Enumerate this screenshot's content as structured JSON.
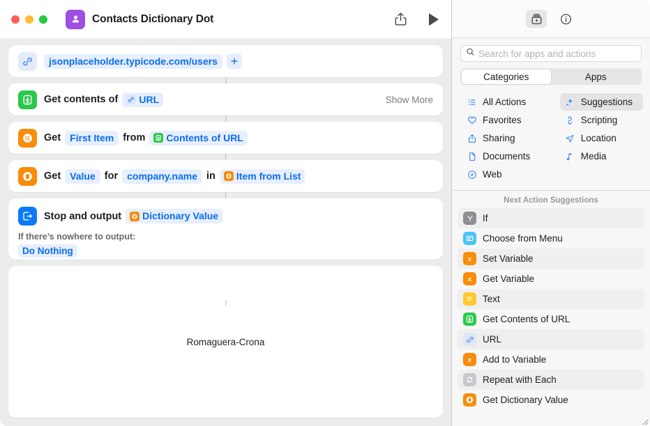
{
  "window": {
    "title": "Contacts Dictionary Dot",
    "app_icon": "contacts-person-icon",
    "accent_purple": "#9e4ee2",
    "traffic_lights": [
      "close",
      "minimize",
      "zoom"
    ],
    "toolbar": {
      "share_label": "share-icon",
      "run_label": "play-icon"
    }
  },
  "editor": {
    "actions": [
      {
        "id": "url",
        "icon": "link-icon",
        "icon_color": "#e3ecfd",
        "value_chip": "jsonplaceholder.typicode.com/users",
        "add_label": "+"
      },
      {
        "id": "get-contents-of-url",
        "icon": "download-box-icon",
        "icon_color": "#2bc84b",
        "label": "Get contents of",
        "token": {
          "text": "URL",
          "icon": "link-icon",
          "icon_color": "#dbe6fb"
        },
        "trailing": "Show More"
      },
      {
        "id": "get-item-from-list",
        "icon": "list-icon",
        "icon_color": "#f88c0b",
        "prefix": "Get",
        "chip1": "First Item",
        "middle": "from",
        "token": {
          "text": "Contents of URL",
          "icon": "download-box-icon",
          "icon_color": "#2bc84b"
        }
      },
      {
        "id": "get-dictionary-value",
        "icon": "dictionary-icon",
        "icon_color": "#f88c0b",
        "prefix": "Get",
        "chip1": "Value",
        "middle": "for",
        "chip2": "company.name",
        "middle2": "in",
        "token": {
          "text": "Item from List",
          "icon": "dictionary-icon",
          "icon_color": "#f88c0b"
        }
      },
      {
        "id": "stop-and-output",
        "icon": "stop-output-icon",
        "icon_color": "#0a7bf8",
        "label": "Stop and output",
        "token": {
          "text": "Dictionary Value",
          "icon": "dictionary-icon",
          "icon_color": "#f88c0b"
        },
        "sub_label": "If there’s nowhere to output:",
        "sub_value": "Do Nothing"
      }
    ],
    "result": {
      "text": "Romaguera-Crona"
    }
  },
  "library": {
    "toolbar": {
      "action_library_icon": "action-library-icon",
      "info_icon": "info-circle-icon"
    },
    "search": {
      "placeholder": "Search for apps and actions",
      "value": "",
      "icon": "search-icon"
    },
    "segmented": {
      "options": [
        "Categories",
        "Apps"
      ],
      "selected": "Categories"
    },
    "categories_left": [
      {
        "label": "All Actions",
        "icon": "list-bullet-icon",
        "selected": false
      },
      {
        "label": "Favorites",
        "icon": "heart-icon",
        "selected": false
      },
      {
        "label": "Sharing",
        "icon": "share-icon",
        "selected": false
      },
      {
        "label": "Documents",
        "icon": "document-icon",
        "selected": false
      },
      {
        "label": "Web",
        "icon": "safari-compass-icon",
        "selected": false
      }
    ],
    "categories_right": [
      {
        "label": "Suggestions",
        "icon": "sparkle-icon",
        "selected": true
      },
      {
        "label": "Scripting",
        "icon": "scripting-icon",
        "selected": false
      },
      {
        "label": "Location",
        "icon": "location-arrow-icon",
        "selected": false
      },
      {
        "label": "Media",
        "icon": "music-note-icon",
        "selected": false
      }
    ],
    "suggestions_header": "Next Action Suggestions",
    "suggestions": [
      {
        "label": "If",
        "icon": "if-branch-icon",
        "icon_color": "#8e8e93",
        "alt": true
      },
      {
        "label": "Choose from Menu",
        "icon": "menu-icon",
        "icon_color": "#4cc3f5",
        "alt": false
      },
      {
        "label": "Set Variable",
        "icon": "variable-icon",
        "icon_color": "#f88c0b",
        "alt": true
      },
      {
        "label": "Get Variable",
        "icon": "variable-icon",
        "icon_color": "#f88c0b",
        "alt": false
      },
      {
        "label": "Text",
        "icon": "text-icon",
        "icon_color": "#fdc930",
        "alt": true
      },
      {
        "label": "Get Contents of URL",
        "icon": "download-box-icon",
        "icon_color": "#2bc84b",
        "alt": false
      },
      {
        "label": "URL",
        "icon": "link-icon",
        "icon_color": "#dde7f7",
        "alt": true
      },
      {
        "label": "Add to Variable",
        "icon": "variable-icon",
        "icon_color": "#f88c0b",
        "alt": false
      },
      {
        "label": "Repeat with Each",
        "icon": "repeat-icon",
        "icon_color": "#c7c7cc",
        "alt": true
      },
      {
        "label": "Get Dictionary Value",
        "icon": "dictionary-icon",
        "icon_color": "#f88c0b",
        "alt": false
      }
    ]
  }
}
